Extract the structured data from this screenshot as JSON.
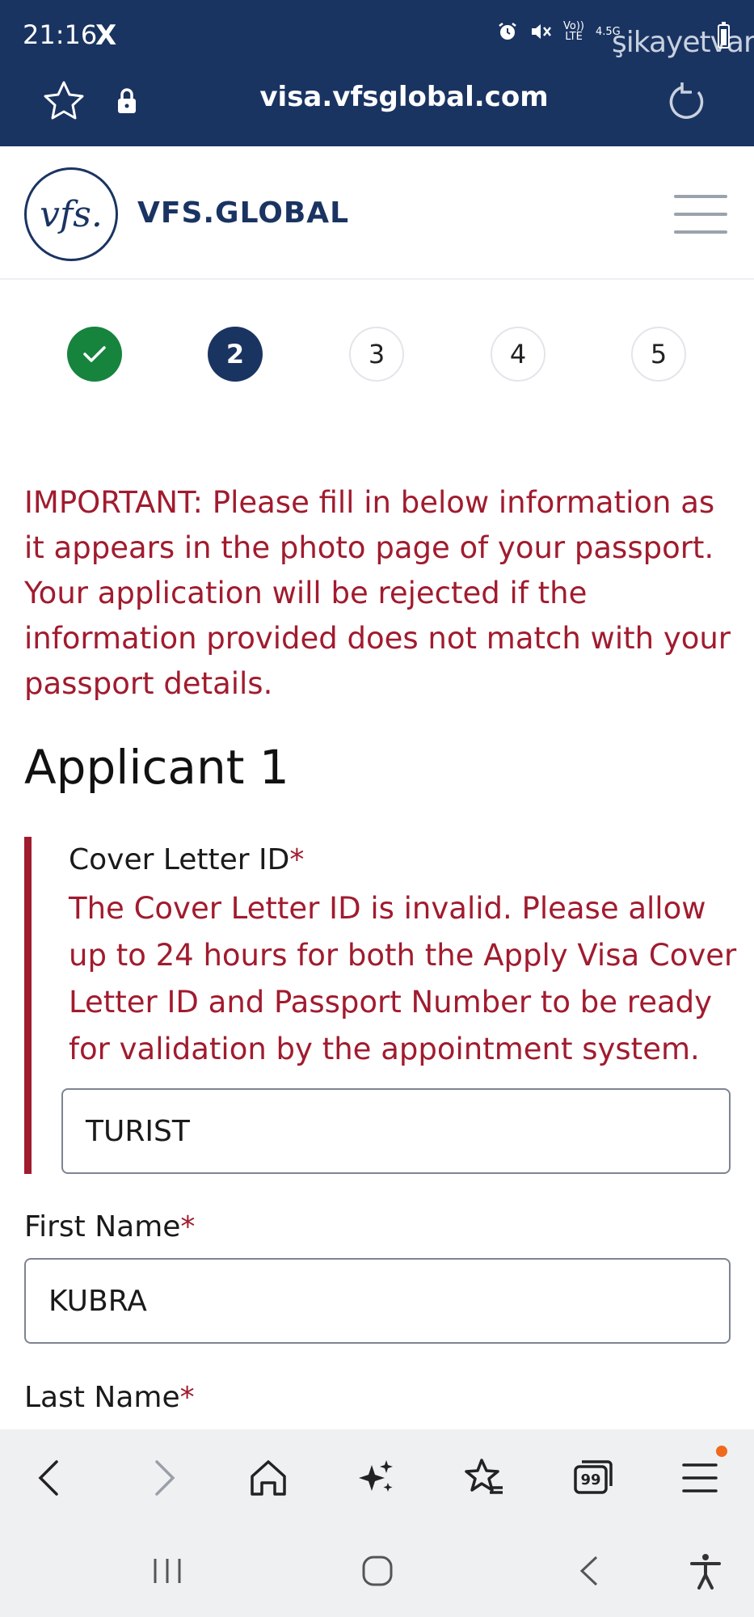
{
  "status_bar": {
    "time": "21:16",
    "app_icon": "X",
    "network_top": "Vo))",
    "network_bottom": "LTE",
    "net_speed": "4.5G",
    "battery": "%90",
    "watermark": "şikayetvar"
  },
  "browser": {
    "url": "visa.vfsglobal.com",
    "icons": [
      "star-icon",
      "lock-icon",
      "reload-icon"
    ]
  },
  "site": {
    "logo_text": "vfs.",
    "brand": "VFS.GLOBAL"
  },
  "stepper": {
    "steps": [
      "✓",
      "2",
      "3",
      "4",
      "5"
    ],
    "current": 2
  },
  "form": {
    "important_notice": "IMPORTANT: Please fill in below information as it appears in the photo page of your passport. Your application will be rejected if the information provided does not match with your passport details.",
    "applicant_title": "Applicant 1",
    "cover_letter": {
      "label": "Cover Letter ID",
      "required_mark": "*",
      "error": "The Cover Letter ID is invalid. Please allow up to 24 hours for both the Apply Visa Cover Letter ID and Passport Number to be ready for validation by the appointment system.",
      "value": "TURIST"
    },
    "first_name": {
      "label": "First Name",
      "required_mark": "*",
      "value": "KUBRA"
    },
    "last_name": {
      "label": "Last Name",
      "required_mark": "*"
    }
  },
  "bottom_toolbar": {
    "tabs_count": "99",
    "icons": [
      "back-icon",
      "forward-icon",
      "home-icon",
      "sparkle-icon",
      "bookmarks-icon",
      "tabs-icon",
      "menu-icon"
    ]
  },
  "system_nav": {
    "icons": [
      "recents-icon",
      "home-circle-icon",
      "nav-back-icon",
      "accessibility-icon"
    ]
  }
}
